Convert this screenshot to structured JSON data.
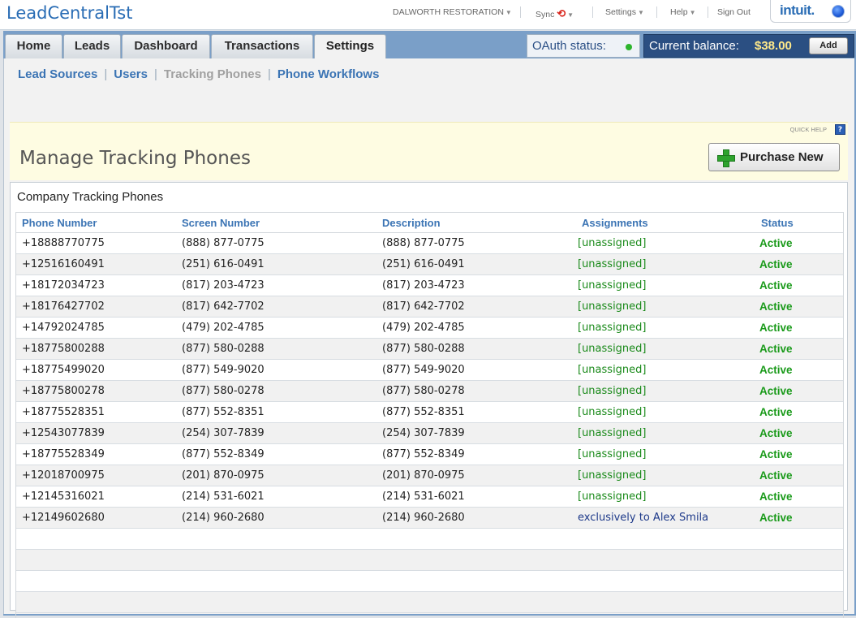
{
  "app_title": "LeadCentralTst",
  "topnav": {
    "company": "DALWORTH RESTORATION",
    "sync": "Sync",
    "settings": "Settings",
    "help": "Help",
    "sign_out": "Sign Out",
    "brand": "intuit."
  },
  "tabs": [
    {
      "label": "Home"
    },
    {
      "label": "Leads"
    },
    {
      "label": "Dashboard"
    },
    {
      "label": "Transactions"
    },
    {
      "label": "Settings",
      "active": true
    }
  ],
  "oauth": {
    "label": "OAuth status:",
    "status_color": "#2db52d"
  },
  "balance": {
    "label": "Current balance:",
    "amount": "$38.00",
    "add_label": "Add"
  },
  "subnav": [
    {
      "label": "Lead Sources"
    },
    {
      "label": "Users"
    },
    {
      "label": "Tracking Phones",
      "current": true
    },
    {
      "label": "Phone Workflows"
    }
  ],
  "quick_help": "QUICK HELP",
  "page_title": "Manage Tracking Phones",
  "purchase_button": "Purchase New",
  "table": {
    "caption": "Company Tracking Phones",
    "columns": [
      "Phone Number",
      "Screen Number",
      "Description",
      "Assignments",
      "Status"
    ],
    "rows": [
      [
        "+18888770775",
        "(888) 877-0775",
        "(888) 877-0775",
        "[unassigned]",
        "Active"
      ],
      [
        "+12516160491",
        "(251) 616-0491",
        "(251) 616-0491",
        "[unassigned]",
        "Active"
      ],
      [
        "+18172034723",
        "(817) 203-4723",
        "(817) 203-4723",
        "[unassigned]",
        "Active"
      ],
      [
        "+18176427702",
        "(817) 642-7702",
        "(817) 642-7702",
        "[unassigned]",
        "Active"
      ],
      [
        "+14792024785",
        "(479) 202-4785",
        "(479) 202-4785",
        "[unassigned]",
        "Active"
      ],
      [
        "+18775800288",
        "(877) 580-0288",
        "(877) 580-0288",
        "[unassigned]",
        "Active"
      ],
      [
        "+18775499020",
        "(877) 549-9020",
        "(877) 549-9020",
        "[unassigned]",
        "Active"
      ],
      [
        "+18775800278",
        "(877) 580-0278",
        "(877) 580-0278",
        "[unassigned]",
        "Active"
      ],
      [
        "+18775528351",
        "(877) 552-8351",
        "(877) 552-8351",
        "[unassigned]",
        "Active"
      ],
      [
        "+12543077839",
        "(254) 307-7839",
        "(254) 307-7839",
        "[unassigned]",
        "Active"
      ],
      [
        "+18775528349",
        "(877) 552-8349",
        "(877) 552-8349",
        "[unassigned]",
        "Active"
      ],
      [
        "+12018700975",
        "(201) 870-0975",
        "(201) 870-0975",
        "[unassigned]",
        "Active"
      ],
      [
        "+12145316021",
        "(214) 531-6021",
        "(214) 531-6021",
        "[unassigned]",
        "Active"
      ],
      [
        "+12149602680",
        "(214) 960-2680",
        "(214) 960-2680",
        "exclusively to Alex Smilans",
        "Active"
      ]
    ]
  }
}
